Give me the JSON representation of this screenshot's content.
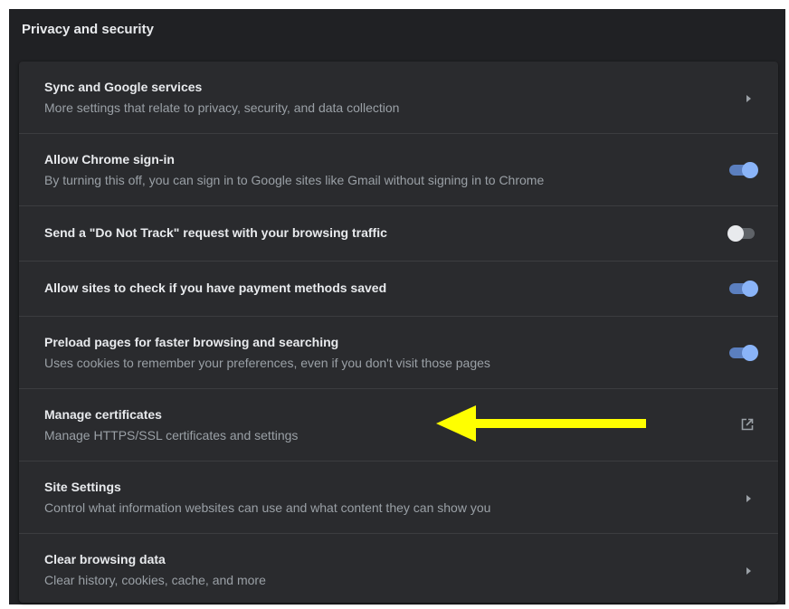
{
  "section": {
    "title": "Privacy and security"
  },
  "rows": [
    {
      "label": "Sync and Google services",
      "sub": "More settings that relate to privacy, security, and data collection",
      "control": "chevron-right-icon"
    },
    {
      "label": "Allow Chrome sign-in",
      "sub": "By turning this off, you can sign in to Google sites like Gmail without signing in to Chrome",
      "control": "toggle",
      "state": "on"
    },
    {
      "label": "Send a \"Do Not Track\" request with your browsing traffic",
      "control": "toggle",
      "state": "off"
    },
    {
      "label": "Allow sites to check if you have payment methods saved",
      "control": "toggle",
      "state": "on"
    },
    {
      "label": "Preload pages for faster browsing and searching",
      "sub": "Uses cookies to remember your preferences, even if you don't visit those pages",
      "control": "toggle",
      "state": "on"
    },
    {
      "label": "Manage certificates",
      "sub": "Manage HTTPS/SSL certificates and settings",
      "control": "open-in-new-icon"
    },
    {
      "label": "Site Settings",
      "sub": "Control what information websites can use and what content they can show you",
      "control": "chevron-right-icon"
    },
    {
      "label": "Clear browsing data",
      "sub": "Clear history, cookies, cache, and more",
      "control": "chevron-right-icon"
    }
  ],
  "annotation": {
    "icon": "yellow-arrow-left-icon",
    "color": "#ffff00"
  },
  "colors": {
    "background": "#202124",
    "card": "#2a2b2e",
    "toggle_on": "#8ab4f8",
    "toggle_off_knob": "#e8eaed",
    "primary_text": "#e8eaed",
    "secondary_text": "#9aa0a6"
  }
}
